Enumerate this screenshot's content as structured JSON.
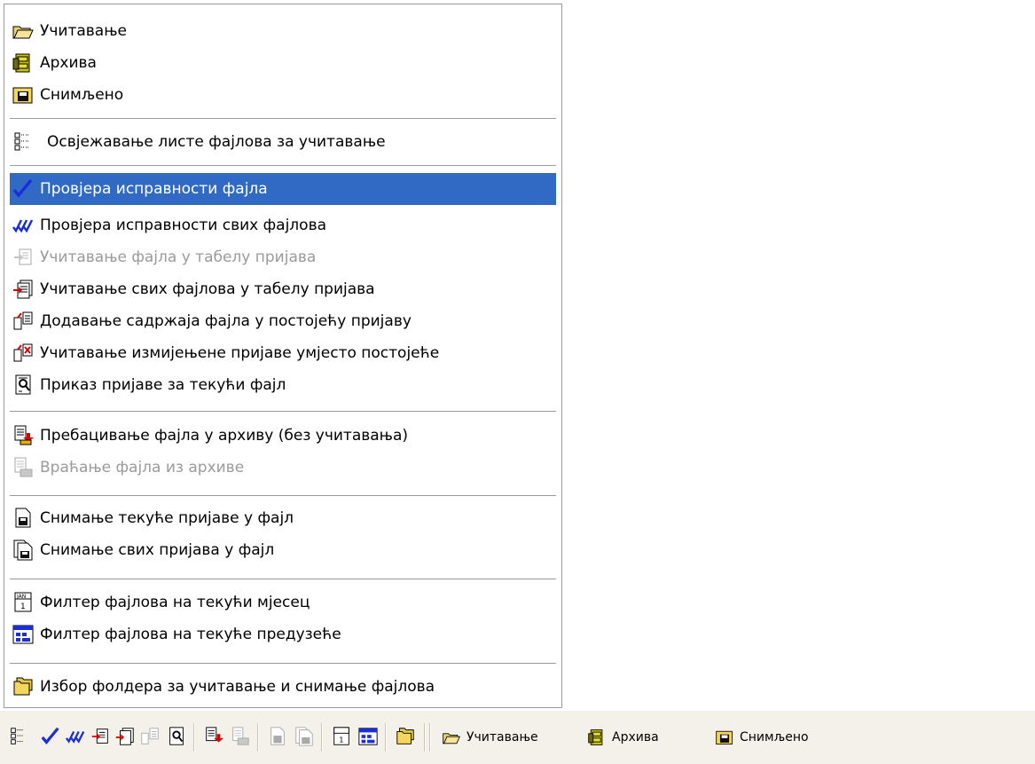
{
  "menu": {
    "items": [
      {
        "label": "Учитавање",
        "icon": "folder-open-icon"
      },
      {
        "label": "Архива",
        "icon": "archive-cabinet-icon"
      },
      {
        "label": "Снимљено",
        "icon": "saved-folder-icon"
      },
      {
        "label": "Освјежавање листе фајлова за учитавање",
        "icon": "refresh-list-icon"
      },
      {
        "label": "Провјера исправности фајла",
        "icon": "check-icon",
        "state": "selected"
      },
      {
        "label": "Провјера исправности свих фајлова",
        "icon": "check-all-icon"
      },
      {
        "label": "Учитавање фајла у табелу пријава",
        "icon": "load-file-icon",
        "state": "disabled"
      },
      {
        "label": "Учитавање свих фајлова у табелу пријава",
        "icon": "load-all-files-icon"
      },
      {
        "label": "Додавање садржаја фајла у постојећу пријаву",
        "icon": "add-content-icon"
      },
      {
        "label": "Учитавање измијењене пријаве умјесто постојеће",
        "icon": "replace-report-icon"
      },
      {
        "label": "Приказ пријаве за текући фајл",
        "icon": "view-report-icon"
      },
      {
        "label": "Пребацивање фајла у архиву (без учитавања)",
        "icon": "move-to-archive-icon"
      },
      {
        "label": "Враћање фајла из архиве",
        "icon": "restore-from-archive-icon",
        "state": "disabled"
      },
      {
        "label": "Снимање текуће пријаве у фајл",
        "icon": "save-report-icon"
      },
      {
        "label": "Снимање свих пријава у фајл",
        "icon": "save-all-reports-icon"
      },
      {
        "label": "Филтер фајлова на текући мјесец",
        "icon": "calendar-filter-icon"
      },
      {
        "label": "Филтер фајлова на текуће предузеће",
        "icon": "company-filter-icon"
      },
      {
        "label": "Избор фолдера за учитавање и снимање фајлова",
        "icon": "choose-folder-icon"
      }
    ]
  },
  "toolbar": {
    "buttons": [
      {
        "label": "Учитавање",
        "icon": "folder-open-icon"
      },
      {
        "label": "Архива",
        "icon": "archive-cabinet-icon"
      },
      {
        "label": "Снимљено",
        "icon": "saved-folder-icon"
      }
    ]
  },
  "colors": {
    "selection": "#316ac5",
    "menu_border": "#9c9a9c",
    "toolbar_bg": "#f3f1ea",
    "disabled_text": "#9c9a9c"
  }
}
